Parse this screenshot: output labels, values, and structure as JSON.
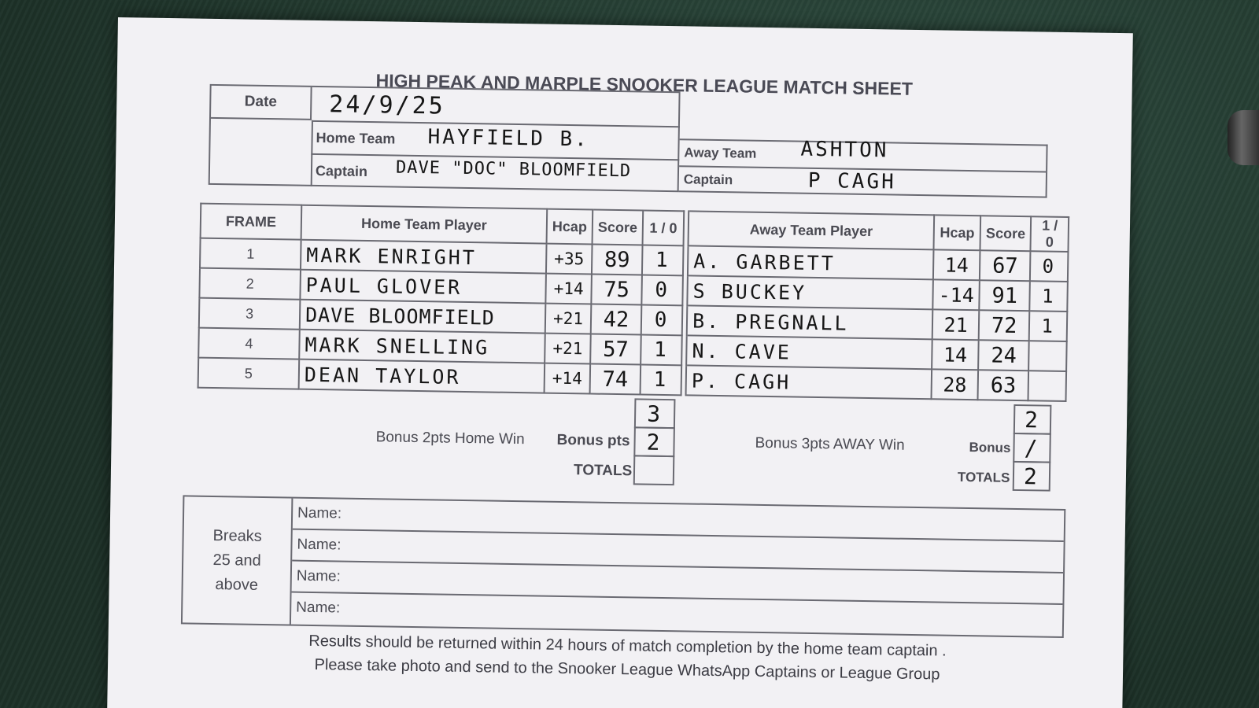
{
  "title": "HIGH PEAK AND MARPLE SNOOKER LEAGUE MATCH SHEET",
  "header": {
    "date_label": "Date",
    "date_value": "24/9/25",
    "home_team_label": "Home Team",
    "home_team_value": "HAYFIELD B.",
    "home_captain_label": "Captain",
    "home_captain_value": "DAVE \"DOC\" BLOOMFIELD",
    "away_team_label": "Away Team",
    "away_team_value": "ASHTON",
    "away_captain_label": "Captain",
    "away_captain_value": "P CAGH"
  },
  "frames_table": {
    "columns": {
      "frame": "FRAME",
      "home_player": "Home Team Player",
      "hcap": "Hcap",
      "score": "Score",
      "result": "1 / 0",
      "away_player": "Away Team Player",
      "away_hcap": "Hcap",
      "away_score": "Score",
      "away_result": "1 / 0"
    },
    "rows": [
      {
        "frame": "1",
        "home_player": "MARK ENRIGHT",
        "hcap": "+35",
        "score": "89",
        "result": "1",
        "away_player": "A. GARBETT",
        "away_hcap": "14",
        "away_score": "67",
        "away_result": "0"
      },
      {
        "frame": "2",
        "home_player": "PAUL GLOVER",
        "hcap": "+14",
        "score": "75",
        "result": "0",
        "away_player": "S BUCKEY",
        "away_hcap": "-14",
        "away_score": "91",
        "away_result": "1"
      },
      {
        "frame": "3",
        "home_player": "DAVE BLOOMFIELD",
        "hcap": "+21",
        "score": "42",
        "result": "0",
        "away_player": "B. PREGNALL",
        "away_hcap": "21",
        "away_score": "72",
        "away_result": "1"
      },
      {
        "frame": "4",
        "home_player": "MARK SNELLING",
        "hcap": "+21",
        "score": "57",
        "result": "1",
        "away_player": "N. CAVE",
        "away_hcap": "14",
        "away_score": "24",
        "away_result": ""
      },
      {
        "frame": "5",
        "home_player": "DEAN TAYLOR",
        "hcap": "+14",
        "score": "74",
        "result": "1",
        "away_player": "P. CAGH",
        "away_hcap": "28",
        "away_score": "63",
        "away_result": ""
      }
    ]
  },
  "totals": {
    "home_frames": "3",
    "home_bonus_label": "Bonus 2pts Home Win",
    "home_bonus_pts_label": "Bonus pts",
    "home_bonus_value": "2",
    "home_totals_label": "TOTALS",
    "home_totals_value": "",
    "away_frames": "2",
    "away_bonus_label": "Bonus 3pts AWAY Win",
    "away_bonus_pts_label": "Bonus",
    "away_bonus_value": "/",
    "away_totals_label": "TOTALS",
    "away_totals_value": "2"
  },
  "breaks": {
    "label_line1": "Breaks",
    "label_line2": "25 and",
    "label_line3": "above",
    "name_labels": [
      "Name:",
      "Name:",
      "Name:",
      "Name:"
    ]
  },
  "footer": {
    "line1": "Results should be returned within 24 hours of match completion by the home team captain .",
    "line2": "Please take photo and send to the Snooker League WhatsApp Captains or League Group"
  }
}
